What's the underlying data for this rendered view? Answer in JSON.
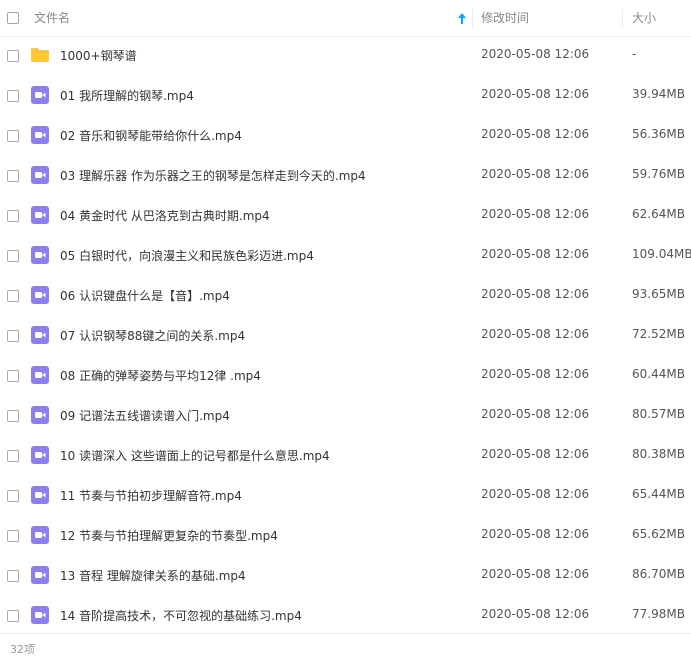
{
  "header": {
    "name_label": "文件名",
    "modified_label": "修改时间",
    "size_label": "大小"
  },
  "colors": {
    "folder": "#ffc83d",
    "video": "#8b7ff1",
    "sort_arrow": "#06a7ff"
  },
  "files": [
    {
      "name": "1000+钢琴谱",
      "type": "folder",
      "date": "2020-05-08 12:06",
      "size": "-"
    },
    {
      "name": "01 我所理解的钢琴.mp4",
      "type": "video",
      "date": "2020-05-08 12:06",
      "size": "39.94MB"
    },
    {
      "name": "02 音乐和钢琴能带给你什么.mp4",
      "type": "video",
      "date": "2020-05-08 12:06",
      "size": "56.36MB"
    },
    {
      "name": "03 理解乐器 作为乐器之王的钢琴是怎样走到今天的.mp4",
      "type": "video",
      "date": "2020-05-08 12:06",
      "size": "59.76MB"
    },
    {
      "name": "04 黄金时代 从巴洛克到古典时期.mp4",
      "type": "video",
      "date": "2020-05-08 12:06",
      "size": "62.64MB"
    },
    {
      "name": "05 白银时代，向浪漫主义和民族色彩迈进.mp4",
      "type": "video",
      "date": "2020-05-08 12:06",
      "size": "109.04MB"
    },
    {
      "name": "06 认识键盘什么是【音】.mp4",
      "type": "video",
      "date": "2020-05-08 12:06",
      "size": "93.65MB"
    },
    {
      "name": "07 认识钢琴88键之间的关系.mp4",
      "type": "video",
      "date": "2020-05-08 12:06",
      "size": "72.52MB"
    },
    {
      "name": "08 正确的弹琴姿势与平均12律 .mp4",
      "type": "video",
      "date": "2020-05-08 12:06",
      "size": "60.44MB"
    },
    {
      "name": "09 记谱法五线谱读谱入门.mp4",
      "type": "video",
      "date": "2020-05-08 12:06",
      "size": "80.57MB"
    },
    {
      "name": "10 读谱深入 这些谱面上的记号都是什么意思.mp4",
      "type": "video",
      "date": "2020-05-08 12:06",
      "size": "80.38MB"
    },
    {
      "name": "11 节奏与节拍初步理解音符.mp4",
      "type": "video",
      "date": "2020-05-08 12:06",
      "size": "65.44MB"
    },
    {
      "name": "12 节奏与节拍理解更复杂的节奏型.mp4",
      "type": "video",
      "date": "2020-05-08 12:06",
      "size": "65.62MB"
    },
    {
      "name": "13 音程 理解旋律关系的基础.mp4",
      "type": "video",
      "date": "2020-05-08 12:06",
      "size": "86.70MB"
    },
    {
      "name": "14 音阶提高技术，不可忽视的基础练习.mp4",
      "type": "video",
      "date": "2020-05-08 12:06",
      "size": "77.98MB"
    }
  ],
  "footer": {
    "count": "32项"
  }
}
